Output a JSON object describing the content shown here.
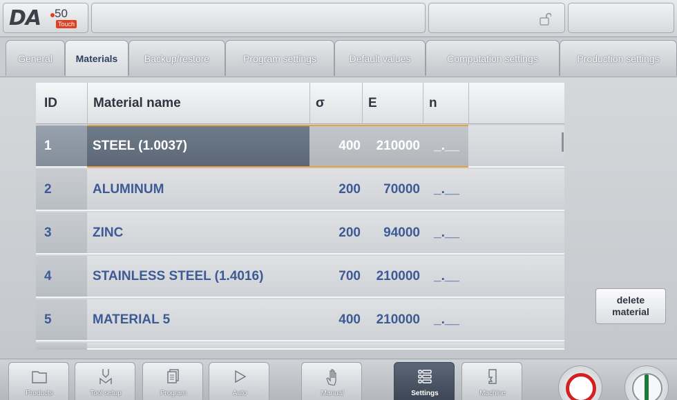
{
  "brand": {
    "name": "DA",
    "model": "50",
    "edition": "Touch"
  },
  "tabs": [
    {
      "label": "General",
      "active": false
    },
    {
      "label": "Materials",
      "active": true
    },
    {
      "label": "Backup/restore",
      "active": false
    },
    {
      "label": "Program settings",
      "active": false
    },
    {
      "label": "Default values",
      "active": false
    },
    {
      "label": "Computation settings",
      "active": false
    },
    {
      "label": "Production settings",
      "active": false
    }
  ],
  "table": {
    "headers": {
      "id": "ID",
      "name": "Material name",
      "sigma": "σ",
      "e": "E",
      "n": "n"
    },
    "rows": [
      {
        "id": "1",
        "name": "STEEL (1.0037)",
        "sigma": "400",
        "e": "210000",
        "n": "_.__",
        "selected": true
      },
      {
        "id": "2",
        "name": "ALUMINUM",
        "sigma": "200",
        "e": "70000",
        "n": "_.__",
        "selected": false
      },
      {
        "id": "3",
        "name": "ZINC",
        "sigma": "200",
        "e": "94000",
        "n": "_.__",
        "selected": false
      },
      {
        "id": "4",
        "name": "STAINLESS STEEL (1.4016)",
        "sigma": "700",
        "e": "210000",
        "n": "_.__",
        "selected": false
      },
      {
        "id": "5",
        "name": "MATERIAL 5",
        "sigma": "400",
        "e": "210000",
        "n": "_.__",
        "selected": false
      }
    ]
  },
  "actions": {
    "delete_material": "delete\nmaterial"
  },
  "nav": [
    {
      "label": "Products",
      "icon": "folder-icon",
      "active": false
    },
    {
      "label": "Tool setup",
      "icon": "tool-setup-icon",
      "active": false
    },
    {
      "label": "Program",
      "icon": "program-pages-icon",
      "active": false
    },
    {
      "label": "Auto",
      "icon": "play-icon",
      "active": false
    },
    {
      "label": "Manual",
      "icon": "hand-icon",
      "active": false
    },
    {
      "label": "Settings",
      "icon": "settings-list-icon",
      "active": true
    },
    {
      "label": "Machine",
      "icon": "machine-icon",
      "active": false
    }
  ],
  "colors": {
    "accent_text": "#3d5a95",
    "selection_line": "#e8a13c",
    "stop": "#d42020",
    "start": "#1d7a3a"
  }
}
